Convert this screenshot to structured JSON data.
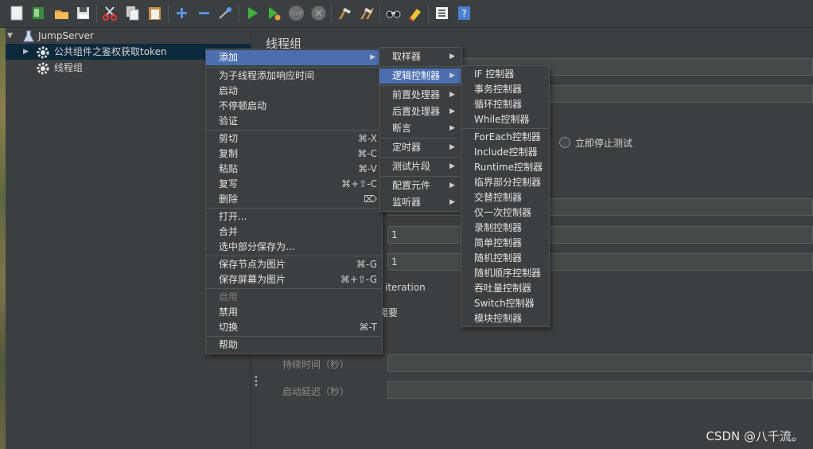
{
  "toolbar": {
    "buttons": [
      "new-icon",
      "templates-icon",
      "open-icon",
      "save-icon",
      "cut-icon",
      "copy-icon",
      "paste-icon",
      "expand-icon",
      "collapse-icon",
      "toggle-icon",
      "start-icon",
      "start-no-pause-icon",
      "stop-icon",
      "shutdown-icon",
      "clear-icon",
      "clear-all-icon",
      "search-icon",
      "reset-search-icon",
      "function-helper-icon",
      "help-icon"
    ],
    "stop_label": "STOP"
  },
  "tree": {
    "root": "JumpServer",
    "items": [
      "公共组件之鉴权获取token",
      "线程组"
    ]
  },
  "panel": {
    "title": "线程组",
    "stop_now_label": "立即停止测试",
    "loop_value": "1",
    "second_value": "1",
    "iteration_label": "iteration",
    "needed_label": "需要",
    "duration_label": "持续时间（秒）",
    "startup_delay_label": "启动延迟（秒）"
  },
  "context_menu": {
    "items": [
      {
        "label": "添加",
        "shortcut": "",
        "submenu": true,
        "active": true
      },
      {
        "label": "为子线程添加响应时间",
        "shortcut": ""
      },
      {
        "label": "启动",
        "shortcut": ""
      },
      {
        "label": "不停顿启动",
        "shortcut": ""
      },
      {
        "label": "验证",
        "shortcut": ""
      },
      {
        "label": "剪切",
        "shortcut": "⌘-X"
      },
      {
        "label": "复制",
        "shortcut": "⌘-C"
      },
      {
        "label": "粘贴",
        "shortcut": "⌘-V"
      },
      {
        "label": "复写",
        "shortcut": "⌘+⇧-C"
      },
      {
        "label": "删除",
        "shortcut": "⌦"
      },
      {
        "label": "打开...",
        "shortcut": ""
      },
      {
        "label": "合并",
        "shortcut": ""
      },
      {
        "label": "选中部分保存为...",
        "shortcut": ""
      },
      {
        "label": "保存节点为图片",
        "shortcut": "⌘-G"
      },
      {
        "label": "保存屏幕为图片",
        "shortcut": "⌘+⇧-G"
      },
      {
        "label": "启用",
        "shortcut": "",
        "disabled": true
      },
      {
        "label": "禁用",
        "shortcut": ""
      },
      {
        "label": "切换",
        "shortcut": "⌘-T"
      },
      {
        "label": "帮助",
        "shortcut": ""
      }
    ]
  },
  "add_menu": {
    "items": [
      "取样器",
      "逻辑控制器",
      "前置处理器",
      "后置处理器",
      "断言",
      "定时器",
      "测试片段",
      "配置元件",
      "监听器"
    ]
  },
  "logic_menu": {
    "items": [
      "IF 控制器",
      "事务控制器",
      "循环控制器",
      "While控制器",
      "ForEach控制器",
      "Include控制器",
      "Runtime控制器",
      "临界部分控制器",
      "交替控制器",
      "仅一次控制器",
      "录制控制器",
      "简单控制器",
      "随机控制器",
      "随机顺序控制器",
      "吞吐量控制器",
      "Switch控制器",
      "模块控制器"
    ]
  },
  "watermark": "CSDN @八千流。",
  "colors": {
    "background": "#3c3f41",
    "highlight": "#4b6eaf",
    "tree_selected": "#0d293e"
  }
}
